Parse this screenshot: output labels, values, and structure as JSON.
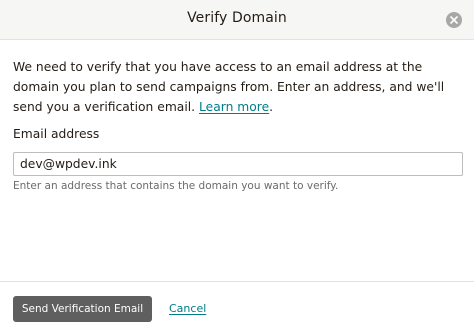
{
  "modal": {
    "title": "Verify Domain",
    "description": "We need to verify that you have access to an email address at the domain you plan to send campaigns from. Enter an address, and we'll send you a verification email.",
    "learn_more": "Learn more",
    "learn_more_suffix": ".",
    "email_label": "Email address",
    "email_value": "dev@wpdev.ink",
    "helper_text": "Enter an address that contains the domain you want to verify.",
    "primary_button": "Send Verification Email",
    "cancel": "Cancel",
    "close_icon": "close-icon"
  },
  "colors": {
    "header_bg": "#f6f6f4",
    "link": "#007c89",
    "primary_button_bg": "#5f5f5f",
    "close_bg": "#a8a8a6"
  }
}
